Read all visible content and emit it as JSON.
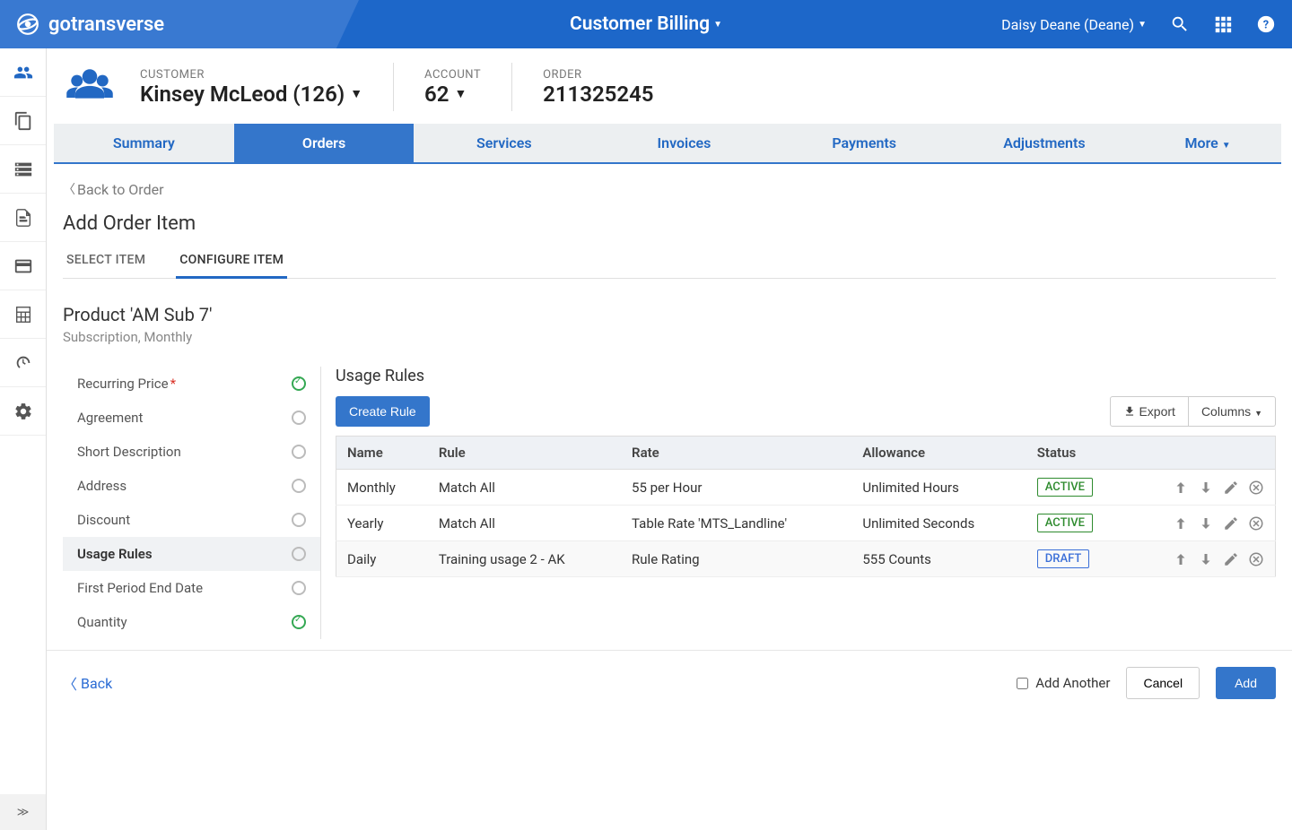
{
  "topbar": {
    "brand": "gotransverse",
    "center": "Customer Billing",
    "user": "Daisy Deane (Deane)"
  },
  "context": {
    "customer_label": "CUSTOMER",
    "customer_value": "Kinsey McLeod (126)",
    "account_label": "ACCOUNT",
    "account_value": "62",
    "order_label": "ORDER",
    "order_value": "211325245"
  },
  "tabs": [
    "Summary",
    "Orders",
    "Services",
    "Invoices",
    "Payments",
    "Adjustments",
    "More"
  ],
  "active_tab": "Orders",
  "back_to_order": "Back to Order",
  "page_title": "Add Order Item",
  "subtabs": [
    "SELECT ITEM",
    "CONFIGURE ITEM"
  ],
  "active_subtab": "CONFIGURE ITEM",
  "product": {
    "title": "Product 'AM Sub 7'",
    "subtitle": "Subscription, Monthly"
  },
  "config_nav": [
    {
      "label": "Recurring Price",
      "required": true,
      "done": true
    },
    {
      "label": "Agreement",
      "required": false,
      "done": false
    },
    {
      "label": "Short Description",
      "required": false,
      "done": false
    },
    {
      "label": "Address",
      "required": false,
      "done": false
    },
    {
      "label": "Discount",
      "required": false,
      "done": false
    },
    {
      "label": "Usage Rules",
      "required": false,
      "done": false,
      "selected": true
    },
    {
      "label": "First Period End Date",
      "required": false,
      "done": false
    },
    {
      "label": "Quantity",
      "required": false,
      "done": true
    }
  ],
  "panel": {
    "title": "Usage Rules",
    "create_btn": "Create Rule",
    "export_btn": "Export",
    "columns_btn": "Columns"
  },
  "table": {
    "headers": [
      "Name",
      "Rule",
      "Rate",
      "Allowance",
      "Status"
    ],
    "rows": [
      {
        "name": "Monthly",
        "rule": "Match All",
        "rate": "55 per Hour",
        "allowance": "Unlimited Hours",
        "status": "ACTIVE"
      },
      {
        "name": "Yearly",
        "rule": "Match All",
        "rate": "Table Rate 'MTS_Landline'",
        "allowance": "Unlimited Seconds",
        "status": "ACTIVE"
      },
      {
        "name": "Daily",
        "rule": "Training usage 2 - AK",
        "rate": "Rule Rating",
        "allowance": "555 Counts",
        "status": "DRAFT"
      }
    ]
  },
  "footer": {
    "back": "Back",
    "add_another": "Add Another",
    "cancel": "Cancel",
    "add": "Add"
  }
}
